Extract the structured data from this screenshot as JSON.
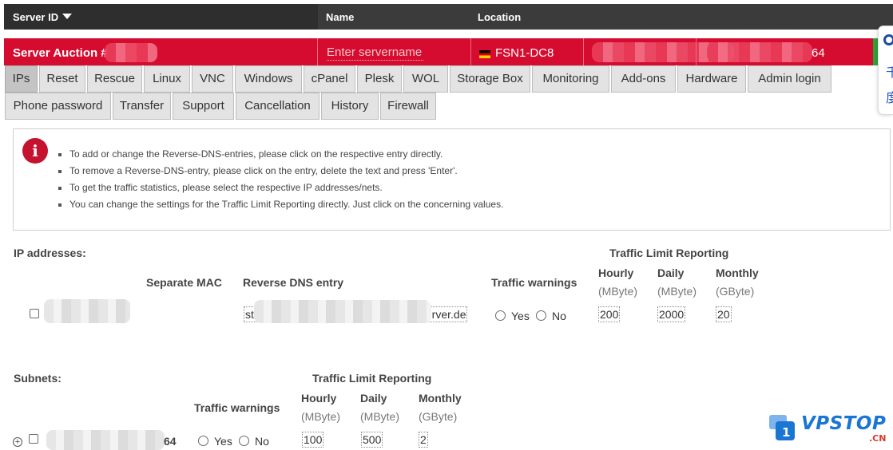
{
  "header": {
    "server_id": "Server ID",
    "name": "Name",
    "location": "Location"
  },
  "auction": {
    "title": "Server Auction #",
    "name_placeholder": "Enter servername",
    "location": "FSN1-DC8",
    "ipv6_suffix": "64"
  },
  "tabs_row1": [
    "IPs",
    "Reset",
    "Rescue",
    "Linux",
    "VNC",
    "Windows",
    "cPanel",
    "Plesk",
    "WOL",
    "Storage Box",
    "Monitoring",
    "Add-ons",
    "Hardware",
    "Admin login"
  ],
  "tabs_row2": [
    "Phone password",
    "Transfer",
    "Support",
    "Cancellation",
    "History",
    "Firewall"
  ],
  "active_tab": "IPs",
  "info": {
    "icon": "i",
    "items": [
      "To add or change the Reverse-DNS-entries, please click on the respective entry directly.",
      "To remove a Reverse-DNS-entry, please click on the entry, delete the text and press 'Enter'.",
      "To get the traffic statistics, please select the respective IP addresses/nets.",
      "You can change the settings for the Traffic Limit Reporting directly. Just click on the concerning values."
    ]
  },
  "ip_section": {
    "title": "IP addresses:",
    "traffic_limit_header": "Traffic Limit Reporting",
    "columns": {
      "separate_mac": "Separate MAC",
      "reverse_dns": "Reverse DNS entry",
      "traffic_warnings": "Traffic warnings",
      "hourly": "Hourly",
      "daily": "Daily",
      "monthly": "Monthly",
      "mbyte": "(MByte)",
      "gbyte": "(GByte)"
    },
    "row": {
      "rdns_prefix": "st",
      "rdns_suffix": "erver.de",
      "yes": "Yes",
      "no": "No",
      "hourly": "200",
      "daily": "2000",
      "monthly": "20"
    }
  },
  "subnet_section": {
    "title": "Subnets:",
    "traffic_limit_header": "Traffic Limit Reporting",
    "columns": {
      "traffic_warnings": "Traffic warnings",
      "hourly": "Hourly",
      "daily": "Daily",
      "monthly": "Monthly",
      "mbyte": "(MByte)",
      "gbyte": "(GByte)"
    },
    "row": {
      "subnet_suffix": "64",
      "yes": "Yes",
      "no": "No",
      "hourly": "100",
      "daily": "500",
      "monthly": "2"
    }
  },
  "watermark": {
    "logo_digit": "1",
    "brand": "VPSTOP",
    "tld": ".CN"
  }
}
